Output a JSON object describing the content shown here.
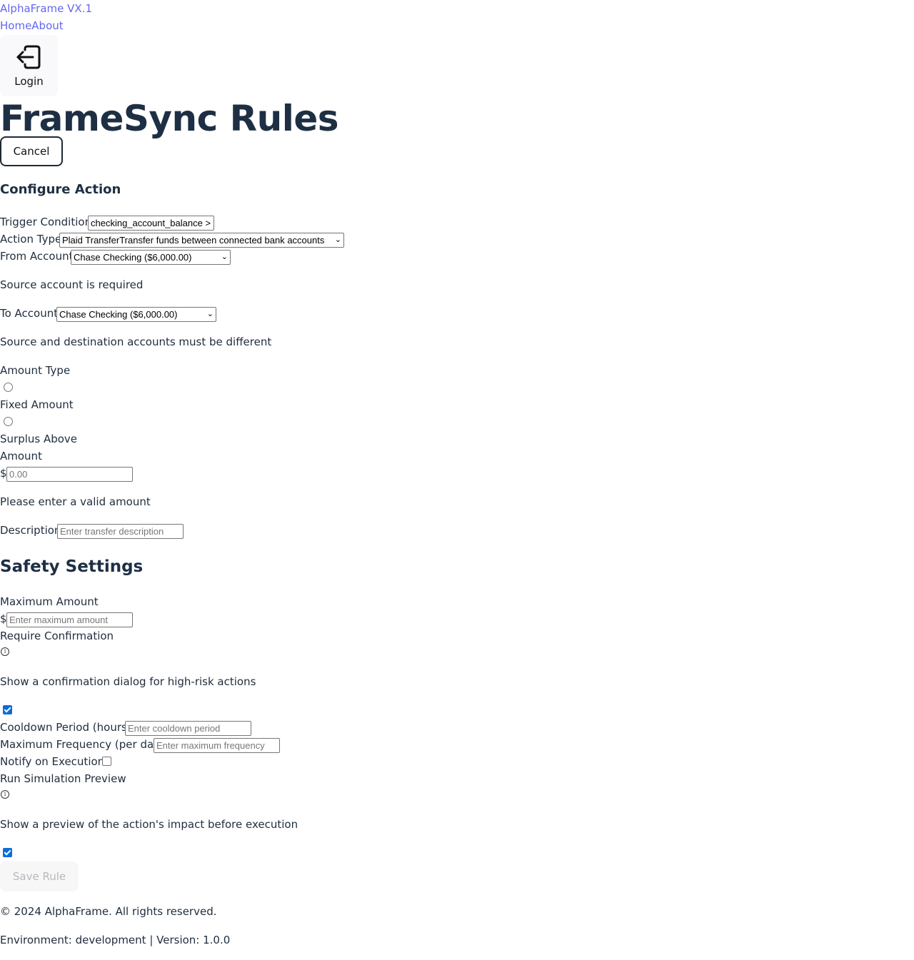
{
  "header": {
    "brand": "AlphaFrame VX.1",
    "nav": [
      "Home",
      "About"
    ],
    "login_label": "Login"
  },
  "page": {
    "title": "FrameSync Rules",
    "cancel_label": "Cancel"
  },
  "configure": {
    "heading": "Configure Action",
    "trigger_label": "Trigger Condition",
    "trigger_value": "checking_account_balance >",
    "action_type_label": "Action Type",
    "action_type_value": "Plaid TransferTransfer funds between connected bank accounts",
    "from_label": "From Account",
    "from_value": "Chase Checking ($6,000.00)",
    "from_error": "Source account is required",
    "to_label": "To Account",
    "to_value": "Chase Checking ($6,000.00)",
    "to_error": "Source and destination accounts must be different",
    "amount_type_label": "Amount Type",
    "amount_type_options": [
      "Fixed Amount",
      "Surplus Above"
    ],
    "amount_label": "Amount",
    "currency_symbol": "$",
    "amount_placeholder": "0.00",
    "amount_error": "Please enter a valid amount",
    "description_label": "Description",
    "description_placeholder": "Enter transfer description"
  },
  "safety": {
    "heading": "Safety Settings",
    "max_amount_label": "Maximum Amount",
    "currency_symbol": "$",
    "max_amount_placeholder": "Enter maximum amount",
    "require_confirmation_label": "Require Confirmation",
    "require_confirmation_help": "Show a confirmation dialog for high-risk actions",
    "require_confirmation_checked": true,
    "cooldown_label": "Cooldown Period (hours)",
    "cooldown_placeholder": "Enter cooldown period",
    "max_frequency_label": "Maximum Frequency (per day)",
    "max_frequency_placeholder": "Enter maximum frequency",
    "notify_label": "Notify on Execution",
    "notify_checked": false,
    "simulation_label": "Run Simulation Preview",
    "simulation_help": "Show a preview of the action's impact before execution",
    "simulation_checked": true,
    "save_label": "Save Rule"
  },
  "footer": {
    "copyright": "© 2024 AlphaFrame. All rights reserved.",
    "env": "Environment: development | Version: 1.0.0"
  },
  "colors": {
    "link": "#6366f1",
    "heading": "#1e2f44",
    "checkbox_accent": "#0b6cde"
  }
}
